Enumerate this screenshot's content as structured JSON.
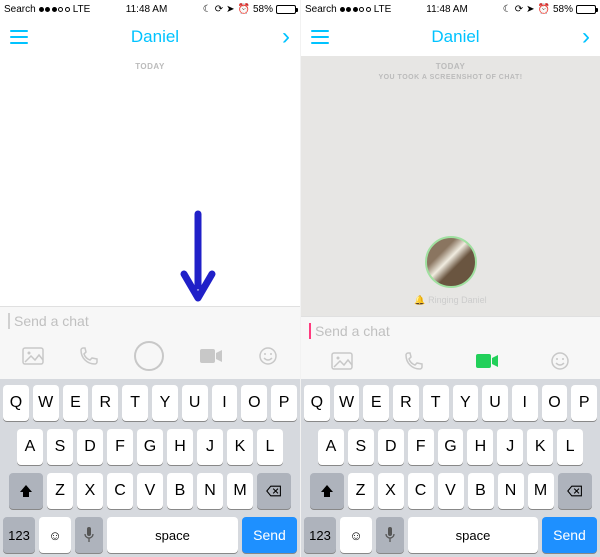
{
  "status": {
    "back": "Search",
    "carrier": "LTE",
    "time": "11:48 AM",
    "battery_pct": "58%"
  },
  "nav": {
    "title": "Daniel"
  },
  "left": {
    "day_label": "TODAY",
    "placeholder": "Send a chat",
    "cursor_color": "#d0d0d0"
  },
  "right": {
    "day_label": "TODAY",
    "sub_label": "YOU TOOK A SCREENSHOT OF CHAT!",
    "ringing_text": "Ringing Daniel",
    "placeholder": "Send a chat",
    "cursor_color": "#FF3B7F"
  },
  "keyboard": {
    "row1": [
      "Q",
      "W",
      "E",
      "R",
      "T",
      "Y",
      "U",
      "I",
      "O",
      "P"
    ],
    "row2": [
      "A",
      "S",
      "D",
      "F",
      "G",
      "H",
      "J",
      "K",
      "L"
    ],
    "row3": [
      "Z",
      "X",
      "C",
      "V",
      "B",
      "N",
      "M"
    ],
    "numkey": "123",
    "space": "space",
    "send": "Send"
  },
  "colors": {
    "accent": "#00C3FF",
    "arrow": "#2020C8",
    "active_video": "#22D05A",
    "send_btn": "#1E90FF"
  }
}
